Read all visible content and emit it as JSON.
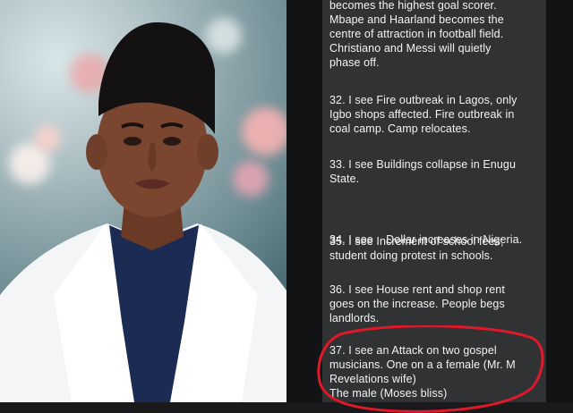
{
  "lines": {
    "prev": [
      "becomes the highest goal scorer.",
      "Mbape and Haarland becomes the",
      "centre of attraction in football field.",
      "Christiano and Messi will quietly",
      "phase off."
    ],
    "p32": [
      "32. I see Fire outbreak in Lagos, only",
      "Igbo shops affected. Fire outbreak in",
      "coal camp. Camp relocates."
    ],
    "p33": [
      "33. I see Buildings collapse in Enugu",
      "State."
    ],
    "p34": [
      "34. I see    Dollar increases in Nigeria."
    ],
    "p35": [
      "35. I see Increment of school fees;",
      "student doing protest in schools."
    ],
    "p36": [
      "36. I see House rent and shop rent",
      "goes on the increase. People begs",
      "landlords."
    ],
    "p37": [
      "37. I see an Attack on two gospel",
      "musicians. One on a a female (Mr. M",
      "Revelations wife)",
      "The male (Moses bliss)"
    ]
  },
  "colors": {
    "chat_background": "#121314",
    "bubble": "#303234",
    "text": "#f3f3f3",
    "highlight_circle": "#e0192a"
  }
}
